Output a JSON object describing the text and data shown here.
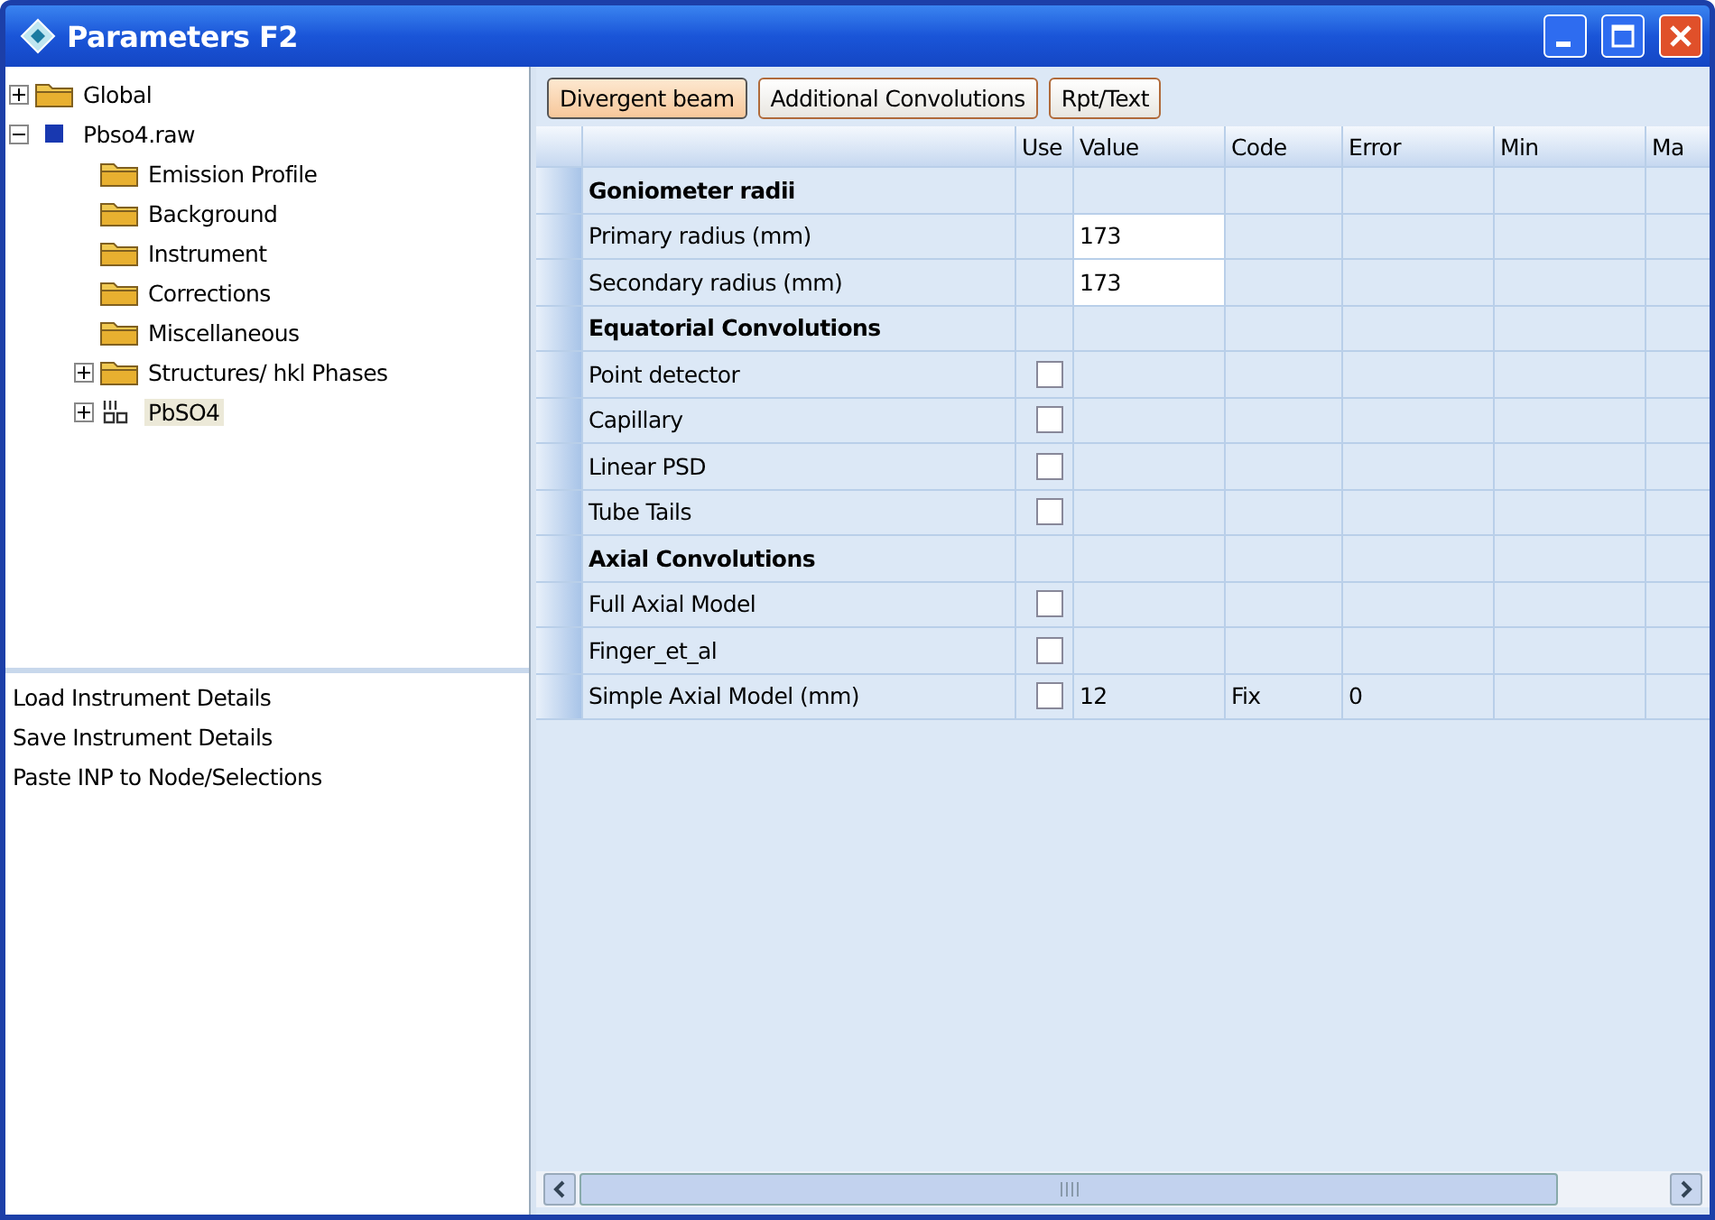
{
  "window": {
    "title": "Parameters F2"
  },
  "tree": [
    {
      "kind": "folder",
      "label": "Global",
      "expanded": false,
      "selected": false
    },
    {
      "kind": "file",
      "label": "Pbso4.raw",
      "expanded": true,
      "selected": false,
      "children": [
        {
          "kind": "folder",
          "label": "Emission Profile",
          "selected": false
        },
        {
          "kind": "folder",
          "label": "Background",
          "selected": false
        },
        {
          "kind": "folder",
          "label": "Instrument",
          "selected": false
        },
        {
          "kind": "folder",
          "label": "Corrections",
          "selected": false
        },
        {
          "kind": "folder",
          "label": "Miscellaneous",
          "selected": false
        },
        {
          "kind": "folder",
          "label": "Structures/ hkl Phases",
          "expanded": false,
          "selected": false
        },
        {
          "kind": "phase",
          "label": "PbSO4",
          "expanded": false,
          "selected": true
        }
      ]
    }
  ],
  "commands": [
    "Load Instrument Details",
    "Save Instrument Details",
    "Paste INP to Node/Selections"
  ],
  "tabs": [
    {
      "label": "Divergent beam",
      "selected": true
    },
    {
      "label": "Additional Convolutions",
      "selected": false
    },
    {
      "label": "Rpt/Text",
      "selected": false
    }
  ],
  "table": {
    "columns": [
      "Use",
      "Value",
      "Code",
      "Error",
      "Min",
      "Ma"
    ],
    "rows": [
      {
        "kind": "group",
        "label": "Goniometer radii"
      },
      {
        "kind": "field",
        "label": "Primary radius (mm)",
        "value": "173"
      },
      {
        "kind": "field",
        "label": "Secondary radius (mm)",
        "value": "173"
      },
      {
        "kind": "group",
        "label": "Equatorial Convolutions"
      },
      {
        "kind": "check",
        "label": "Point detector",
        "checked": false
      },
      {
        "kind": "check",
        "label": "Capillary",
        "checked": false
      },
      {
        "kind": "check",
        "label": "Linear PSD",
        "checked": false
      },
      {
        "kind": "check",
        "label": "Tube Tails",
        "checked": false
      },
      {
        "kind": "group",
        "label": "Axial Convolutions"
      },
      {
        "kind": "check",
        "label": "Full Axial Model",
        "checked": false
      },
      {
        "kind": "check",
        "label": "Finger_et_al",
        "checked": false
      },
      {
        "kind": "check",
        "label": "Simple Axial Model (mm)",
        "checked": false,
        "value": "12",
        "code": "Fix",
        "error": "0"
      }
    ]
  }
}
